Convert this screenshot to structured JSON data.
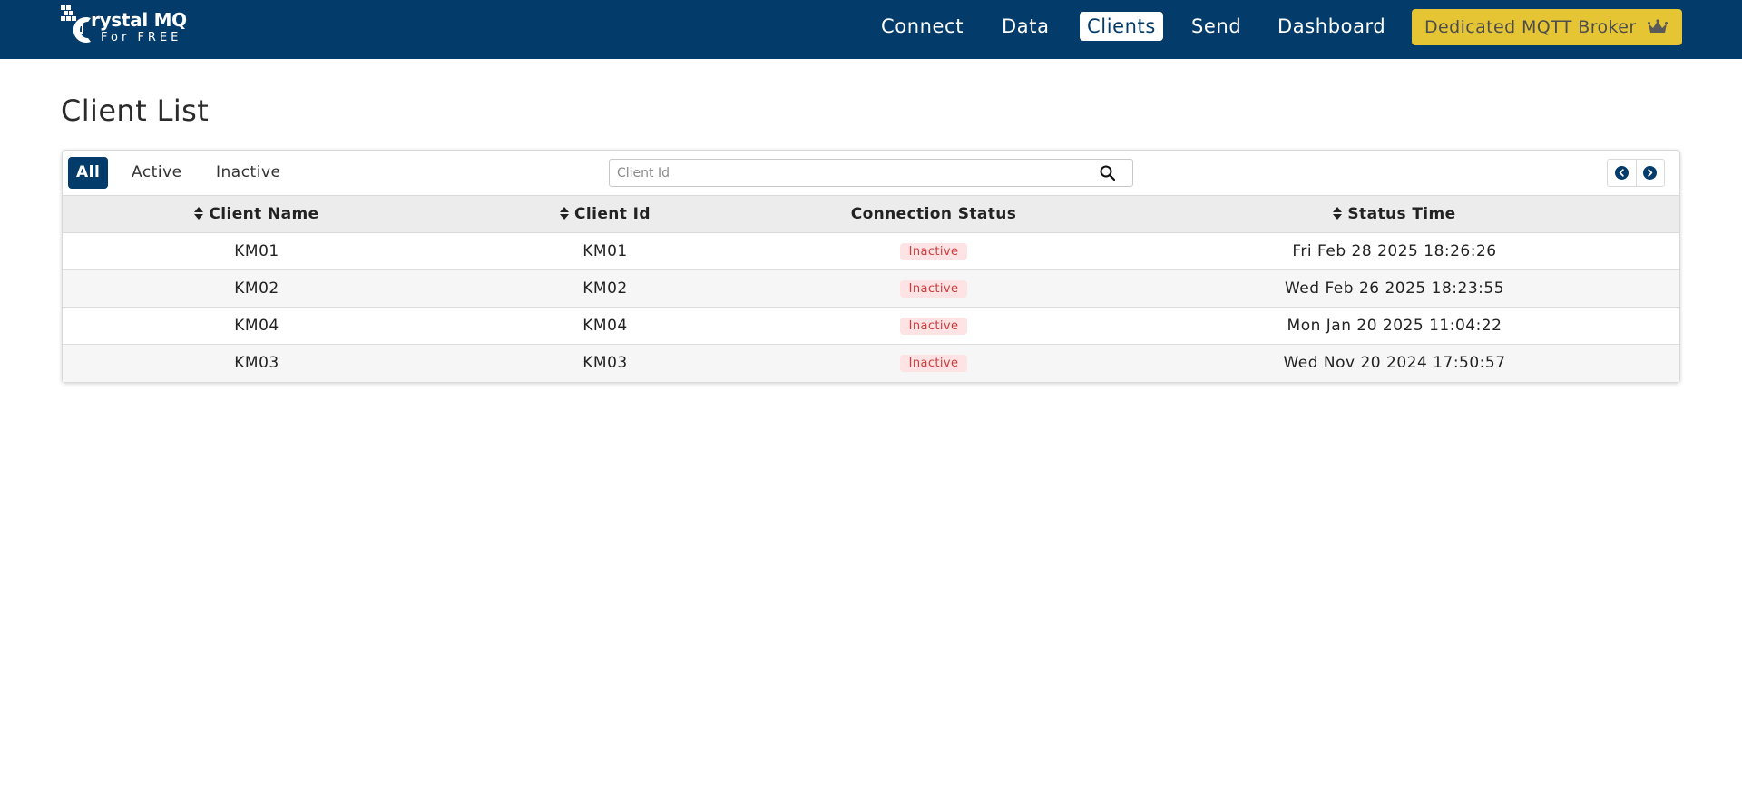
{
  "brand": {
    "title": "rystal MQ",
    "subtitle": "For FREE",
    "logo_icon": "crystal-logo-icon"
  },
  "nav": {
    "links": [
      {
        "label": "Connect"
      },
      {
        "label": "Data"
      },
      {
        "label": "Clients",
        "active": true
      },
      {
        "label": "Send"
      },
      {
        "label": "Dashboard"
      }
    ],
    "premium_button": {
      "label": "Dedicated MQTT Broker",
      "icon": "crown-icon"
    }
  },
  "page": {
    "title": "Client List"
  },
  "filters": {
    "tabs": [
      {
        "label": "All",
        "active": true
      },
      {
        "label": "Active"
      },
      {
        "label": "Inactive"
      }
    ]
  },
  "search": {
    "placeholder": "Client Id",
    "value": "",
    "icon": "search-icon"
  },
  "pagination": {
    "prev_icon": "chevron-left-circle-icon",
    "next_icon": "chevron-right-circle-icon"
  },
  "table": {
    "columns": [
      {
        "label": "Client Name",
        "sortable": true
      },
      {
        "label": "Client Id",
        "sortable": true
      },
      {
        "label": "Connection Status",
        "sortable": false
      },
      {
        "label": "Status Time",
        "sortable": true
      }
    ],
    "rows": [
      {
        "name": "KM01",
        "id": "KM01",
        "status": "Inactive",
        "time": "Fri Feb 28 2025 18:26:26"
      },
      {
        "name": "KM02",
        "id": "KM02",
        "status": "Inactive",
        "time": "Wed Feb 26 2025 18:23:55"
      },
      {
        "name": "KM04",
        "id": "KM04",
        "status": "Inactive",
        "time": "Mon Jan 20 2025 11:04:22"
      },
      {
        "name": "KM03",
        "id": "KM03",
        "status": "Inactive",
        "time": "Wed Nov 20 2024 17:50:57"
      }
    ]
  },
  "colors": {
    "navbar": "#033c6b",
    "premium": "#e6c535",
    "badge_bg": "#fde3e3",
    "badge_text": "#d23b3b"
  }
}
